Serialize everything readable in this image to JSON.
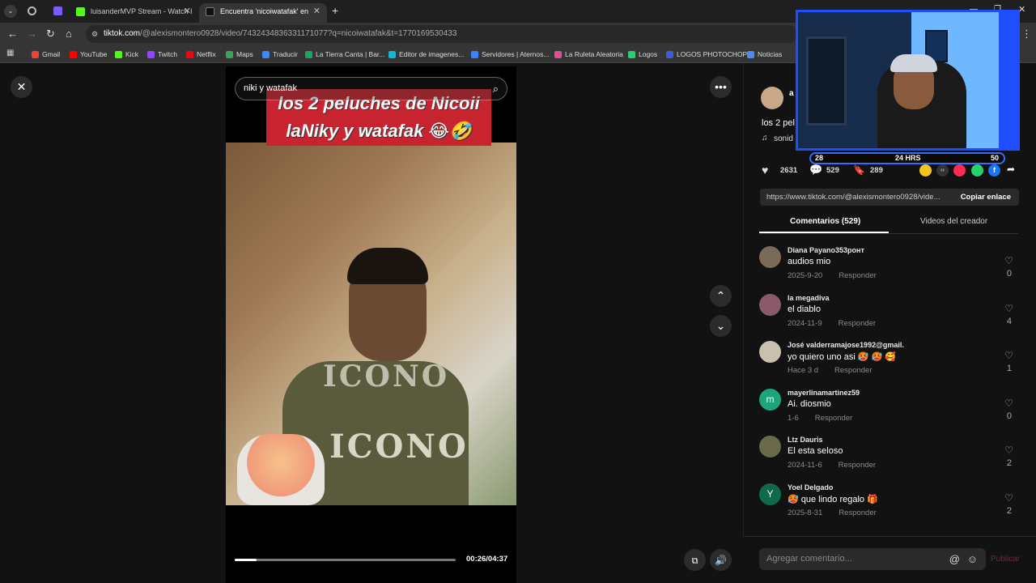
{
  "browser": {
    "tabs": [
      {
        "label": "luisanderMVP Stream - Watch I",
        "favicon_color": "#53fc18",
        "active": false
      },
      {
        "label": "Encuentra 'nicoiwatafak' en",
        "favicon_color": "#111111",
        "active": true
      }
    ],
    "url_domain": "tiktok.com",
    "url_rest": "/@alexismontero0928/video/7432434836331171077?q=nicoiwatafak&t=1770169530433",
    "bookmarks": [
      {
        "label": "Gmail",
        "color": "#ea4335"
      },
      {
        "label": "YouTube",
        "color": "#ff0000"
      },
      {
        "label": "Kick",
        "color": "#53fc18"
      },
      {
        "label": "Twitch",
        "color": "#9146ff"
      },
      {
        "label": "Netflix",
        "color": "#e50914"
      },
      {
        "label": "Maps",
        "color": "#34a853"
      },
      {
        "label": "Traducir",
        "color": "#4285f4"
      },
      {
        "label": "La Tierra Canta | Bar...",
        "color": "#1ea362"
      },
      {
        "label": "Editor de imagenes...",
        "color": "#19b5c9"
      },
      {
        "label": "Servidores | Aternos...",
        "color": "#3b82f6"
      },
      {
        "label": "La Ruleta Aleatoria",
        "color": "#e04e9a"
      },
      {
        "label": "Logos",
        "color": "#2ecc71"
      },
      {
        "label": "LOGOS PHOTOCHOP",
        "color": "#3b5bdb"
      },
      {
        "label": "Noticias",
        "color": "#4c8bf5"
      }
    ]
  },
  "video": {
    "search_query": "niki y watafak",
    "caption_line1": "los 2 peluches de Nicoii",
    "caption_line2": "laNiky y watafak 😂🤣",
    "shirt_text": "ICONO",
    "shirt_small": "CO",
    "time": "00:26/04:37",
    "progress": 0.1
  },
  "panel": {
    "author_initial": "a",
    "desc_start": "los 2 pel",
    "sound_start": "sonid",
    "likes": "2631",
    "comments_count": "529",
    "saves": "289",
    "link": "https://www.tiktok.com/@alexismontero0928/vide...",
    "copy_label": "Copiar enlace",
    "tab_comments": "Comentarios (529)",
    "tab_videos": "Videos del creador",
    "comments": [
      {
        "name": "Diana Payano353ронт",
        "text": "audios mio",
        "date": "2025-9-20",
        "reply": "Responder",
        "likes": "0",
        "avatar_color": "#7a6a5a",
        "avatar_letter": ""
      },
      {
        "name": "la megadiva",
        "text": "el diablo",
        "date": "2024-11-9",
        "reply": "Responder",
        "likes": "4",
        "avatar_color": "#8a5a6a",
        "avatar_letter": ""
      },
      {
        "name": "José valderramajose1992@gmail.",
        "text": "yo quiero uno asi 🥵 🥵 🥰",
        "date": "Hace 3 d",
        "reply": "Responder",
        "likes": "1",
        "avatar_color": "#c9c0b0",
        "avatar_letter": ""
      },
      {
        "name": "mayerlinamartinez59",
        "text": "Ai. diosmio",
        "date": "1-6",
        "reply": "Responder",
        "likes": "0",
        "avatar_color": "#1fa37a",
        "avatar_letter": "m"
      },
      {
        "name": "Ltz Dauris",
        "text": "El esta seloso",
        "date": "2024-11-6",
        "reply": "Responder",
        "likes": "2",
        "avatar_color": "#6a6a4a",
        "avatar_letter": ""
      },
      {
        "name": "Yoel Delgado",
        "text": "🥵 que lindo regalo 🎁",
        "date": "2025-8-31",
        "reply": "Responder",
        "likes": "2",
        "avatar_color": "#0f6a4a",
        "avatar_letter": "Y"
      }
    ],
    "comment_placeholder": "Agregar comentario...",
    "publish_label": "Publicar"
  },
  "stream_overlay": {
    "left": "28",
    "center": "24 HRS",
    "right": "50"
  },
  "colors": {
    "accent_blue": "#1f4dff",
    "tiktok_red": "#fe2c55",
    "caption_bg": "#c8242f"
  }
}
